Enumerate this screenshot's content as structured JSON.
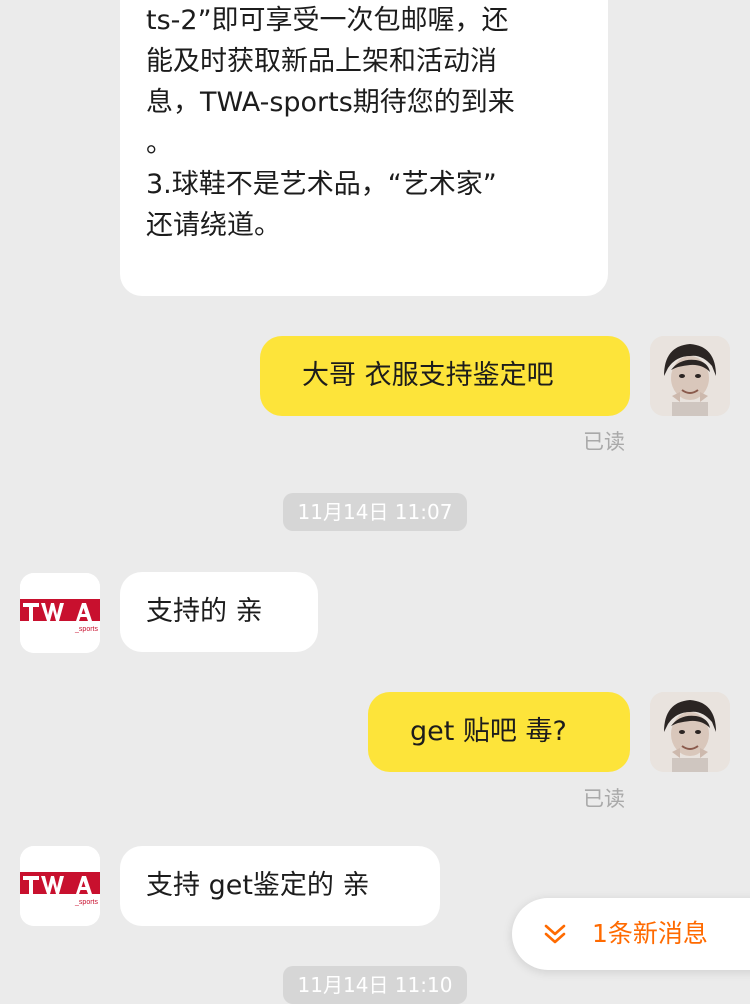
{
  "colors": {
    "background": "#ebebeb",
    "incoming_bubble": "#ffffff",
    "outgoing_bubble": "#fde43a",
    "accent": "#ff6a00",
    "brand_red": "#c8102e"
  },
  "messages": [
    {
      "direction": "incoming",
      "text": "ts-2”即可享受一次包邮喔，还\n能及时获取新品上架和活动消\n息，TWA-sports期待您的到来\n。\n3.球鞋不是艺术品，“艺术家”\n还请绕道。"
    },
    {
      "direction": "outgoing",
      "text": "大哥 衣服支持鉴定吧",
      "status": "已读"
    },
    {
      "direction": "incoming",
      "text": "支持的  亲"
    },
    {
      "direction": "outgoing",
      "text": "get 贴吧 毒?",
      "status": "已读"
    },
    {
      "direction": "incoming",
      "text": "支持 get鉴定的  亲"
    }
  ],
  "timestamps": [
    "11月14日 11:07",
    "11月14日 11:10"
  ],
  "shop_logo": {
    "main": "TWA",
    "sub": "_sports"
  },
  "new_message_toast": {
    "icon": "double-chevron-down-icon",
    "label": "1条新消息"
  }
}
